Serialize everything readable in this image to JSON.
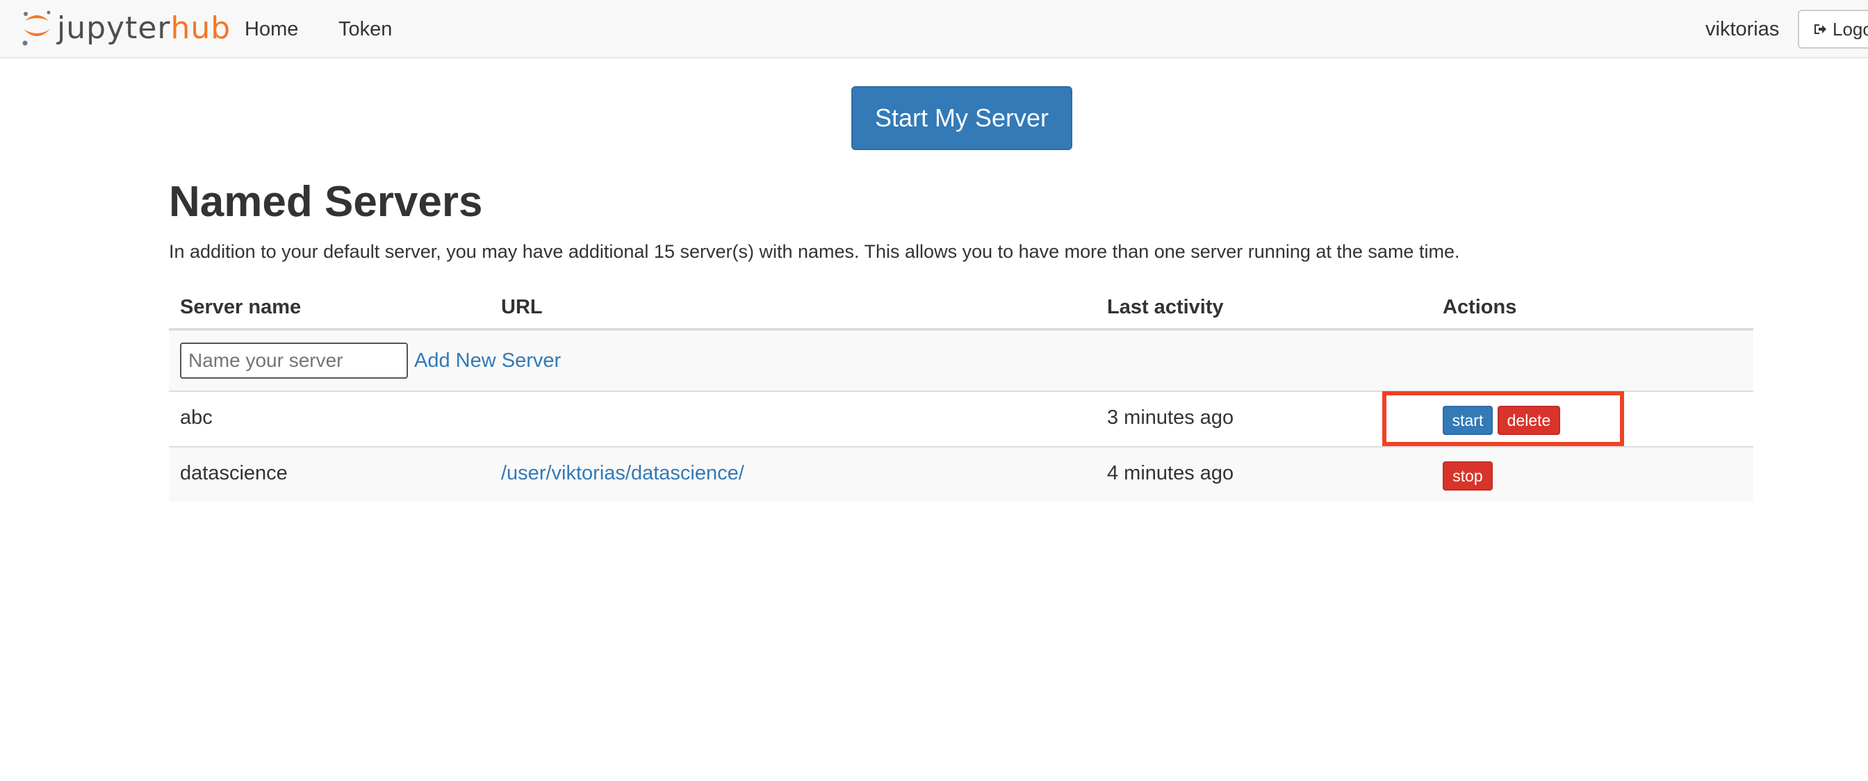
{
  "navbar": {
    "brand": {
      "jupyter": "jupyter",
      "hub": "hub"
    },
    "links": {
      "home": "Home",
      "token": "Token"
    },
    "user": "viktorias",
    "logout_label": "Logo"
  },
  "start_button_label": "Start My Server",
  "named_servers": {
    "title": "Named Servers",
    "description": "In addition to your default server, you may have additional 15 server(s) with names. This allows you to have more than one server running at the same time.",
    "columns": [
      "Server name",
      "URL",
      "Last activity",
      "Actions"
    ],
    "new_server": {
      "placeholder": "Name your server",
      "value": "",
      "add_label": "Add New Server"
    },
    "rows": [
      {
        "name": "abc",
        "url": "",
        "last_activity": "3 minutes ago",
        "actions": [
          "start",
          "delete"
        ]
      },
      {
        "name": "datascience",
        "url": "/user/viktorias/datascience/",
        "last_activity": "4 minutes ago",
        "actions": [
          "stop"
        ]
      }
    ]
  },
  "colors": {
    "primary": "#337ab7",
    "danger": "#d9342b",
    "brand_orange": "#f37726",
    "highlight": "#ef4123"
  },
  "icons": {
    "logo": "jupyter-logo-icon",
    "logout": "sign-out-icon"
  }
}
